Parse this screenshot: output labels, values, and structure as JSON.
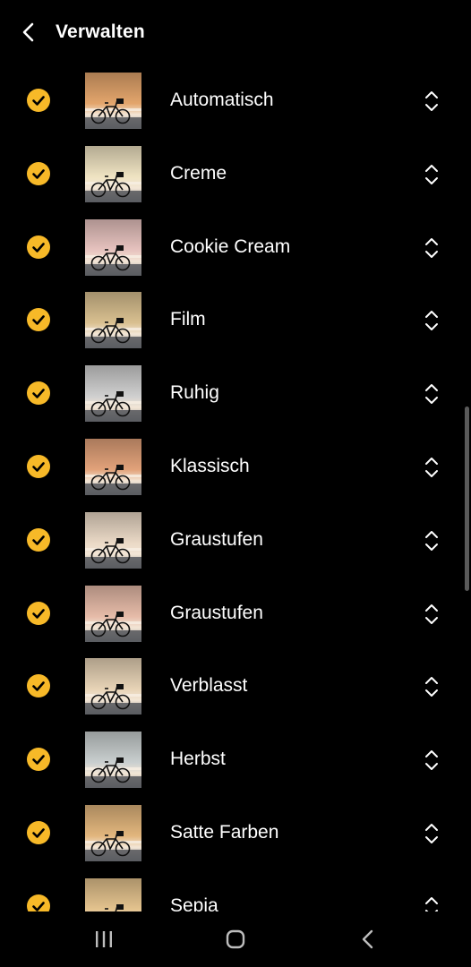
{
  "header": {
    "title": "Verwalten",
    "back_icon": "chevron-left-icon"
  },
  "accent_color": "#f7b928",
  "filters": [
    {
      "label": "Automatisch",
      "checked": true,
      "tint": "#e3a56c"
    },
    {
      "label": "Creme",
      "checked": true,
      "tint": "#efe3c2"
    },
    {
      "label": "Cookie Cream",
      "checked": true,
      "tint": "#e7c3bf"
    },
    {
      "label": "Film",
      "checked": true,
      "tint": "#d9c090"
    },
    {
      "label": "Ruhig",
      "checked": true,
      "tint": "#cfcfcf"
    },
    {
      "label": "Klassisch",
      "checked": true,
      "tint": "#e2a27a"
    },
    {
      "label": "Graustufen",
      "checked": true,
      "tint": "#ead9c6"
    },
    {
      "label": "Graustufen",
      "checked": true,
      "tint": "#e6bba8"
    },
    {
      "label": "Verblasst",
      "checked": true,
      "tint": "#e7d3b6"
    },
    {
      "label": "Herbst",
      "checked": true,
      "tint": "#c9cfcf"
    },
    {
      "label": "Satte Farben",
      "checked": true,
      "tint": "#e2b67d"
    },
    {
      "label": "Sepia",
      "checked": true,
      "tint": "#e4c38e"
    }
  ],
  "nav": {
    "recents_icon": "recents-icon",
    "home_icon": "home-icon",
    "back_icon": "back-icon"
  }
}
